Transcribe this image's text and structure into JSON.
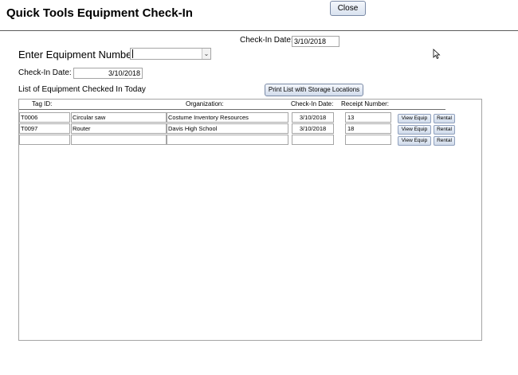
{
  "form": {
    "title": "Quick Tools Equipment Check-In",
    "close_label": "Close"
  },
  "header": {
    "checkin_date_label": "Check-In Date:",
    "checkin_date_value": "3/10/2018",
    "equipment_number_label": "Enter Equipment Number:",
    "equipment_number_value": "",
    "checkin_date2_label": "Check-In Date:",
    "checkin_date2_value": "3/10/2018"
  },
  "list": {
    "title": "List of Equipment Checked In Today",
    "print_button": "Print List with Storage Locations",
    "columns": {
      "tag": "Tag ID:",
      "org": "Organization:",
      "date": "Check-In Date:",
      "receipt": "Receipt Number:"
    },
    "rows": [
      {
        "tag": "T0006",
        "item": "Circular saw",
        "org": "Costume Inventory Resources",
        "date": "3/10/2018",
        "receipt": "13"
      },
      {
        "tag": "T0097",
        "item": "Router",
        "org": "Davis High School",
        "date": "3/10/2018",
        "receipt": "18"
      },
      {
        "tag": "",
        "item": "",
        "org": "",
        "date": "",
        "receipt": ""
      }
    ],
    "view_button": "View Equip",
    "rental_button": "Rental"
  },
  "icons": {
    "mouse_cursor": "arrow-cursor-icon",
    "dropdown": "chevron-down-icon"
  }
}
